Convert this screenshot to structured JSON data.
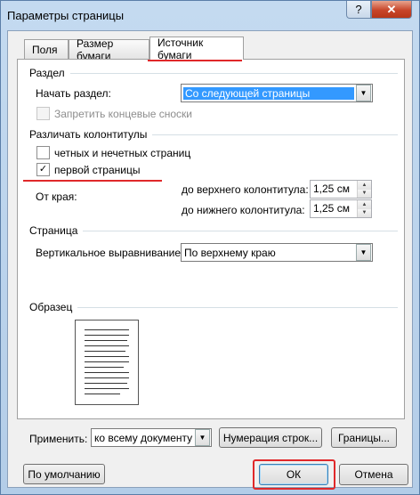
{
  "window": {
    "title": "Параметры страницы",
    "help": "?",
    "close": "✕"
  },
  "tabs": [
    "Поля",
    "Размер бумаги",
    "Источник бумаги"
  ],
  "section": {
    "heading": "Раздел",
    "start_label": "Начать раздел:",
    "start_value": "Со следующей страницы",
    "suppress_endnotes": "Запретить концевые сноски"
  },
  "headers": {
    "heading": "Различать колонтитулы",
    "odd_even": "четных и нечетных страниц",
    "odd_even_checked": false,
    "first_page": "первой страницы",
    "first_page_checked": true,
    "from_edge": "От края:",
    "header_label": "до верхнего колонтитула:",
    "header_value": "1,25 см",
    "footer_label": "до нижнего колонтитула:",
    "footer_value": "1,25 см"
  },
  "page": {
    "heading": "Страница",
    "valign_label": "Вертикальное выравнивание:",
    "valign_value": "По верхнему краю"
  },
  "preview": {
    "heading": "Образец"
  },
  "apply": {
    "label": "Применить:",
    "value": "ко всему документу"
  },
  "buttons": {
    "line_numbers": "Нумерация строк...",
    "borders": "Границы...",
    "default": "По умолчанию",
    "ok": "ОК",
    "cancel": "Отмена"
  }
}
